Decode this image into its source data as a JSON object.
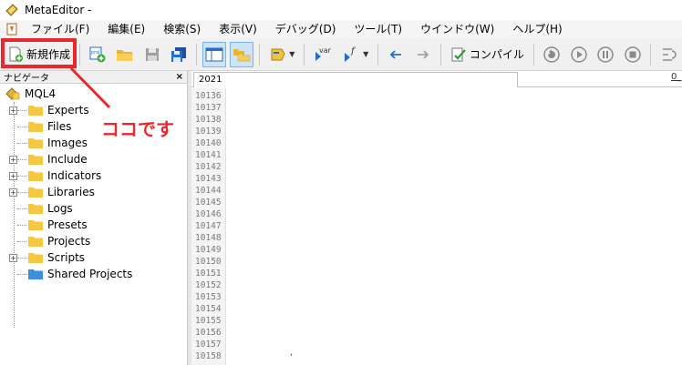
{
  "window": {
    "title": "MetaEditor -"
  },
  "menu": [
    "ファイル(F)",
    "編集(E)",
    "検索(S)",
    "表示(V)",
    "デバッグ(D)",
    "ツール(T)",
    "ウインドウ(W)",
    "ヘルプ(H)"
  ],
  "toolbar": {
    "new_label": "新規作成",
    "compile_label": "コンパイル",
    "var_label": "var",
    "func_label": "f"
  },
  "annotation": {
    "callout": "ココです",
    "color": "#e8282c"
  },
  "navigator": {
    "title": "ナビゲータ",
    "close": "×",
    "root": "MQL4",
    "items": [
      {
        "label": "Experts",
        "expandable": true,
        "expander": "+"
      },
      {
        "label": "Files",
        "expandable": false,
        "expander": ""
      },
      {
        "label": "Images",
        "expandable": false,
        "expander": ""
      },
      {
        "label": "Include",
        "expandable": true,
        "expander": "+"
      },
      {
        "label": "Indicators",
        "expandable": true,
        "expander": "+"
      },
      {
        "label": "Libraries",
        "expandable": true,
        "expander": "+"
      },
      {
        "label": "Logs",
        "expandable": false,
        "expander": ""
      },
      {
        "label": "Presets",
        "expandable": false,
        "expander": ""
      },
      {
        "label": "Projects",
        "expandable": false,
        "expander": ""
      },
      {
        "label": "Scripts",
        "expandable": true,
        "expander": "+"
      },
      {
        "label": "Shared Projects",
        "expandable": false,
        "expander": ""
      }
    ]
  },
  "editor": {
    "tab_label": "2021",
    "tab_right": "0_",
    "line_numbers": [
      "10136",
      "10137",
      "10138",
      "10139",
      "10140",
      "10141",
      "10142",
      "10143",
      "10144",
      "10145",
      "10146",
      "10147",
      "10148",
      "10149",
      "10150",
      "10151",
      "10152",
      "10153",
      "10154",
      "10155",
      "10156",
      "10157",
      "10158"
    ],
    "stray_char": ","
  },
  "colors": {
    "folder": "#f5c842",
    "shared_folder": "#3c8fdc",
    "accent_blue": "#1e6fd0",
    "annotation_red": "#e8282c"
  }
}
